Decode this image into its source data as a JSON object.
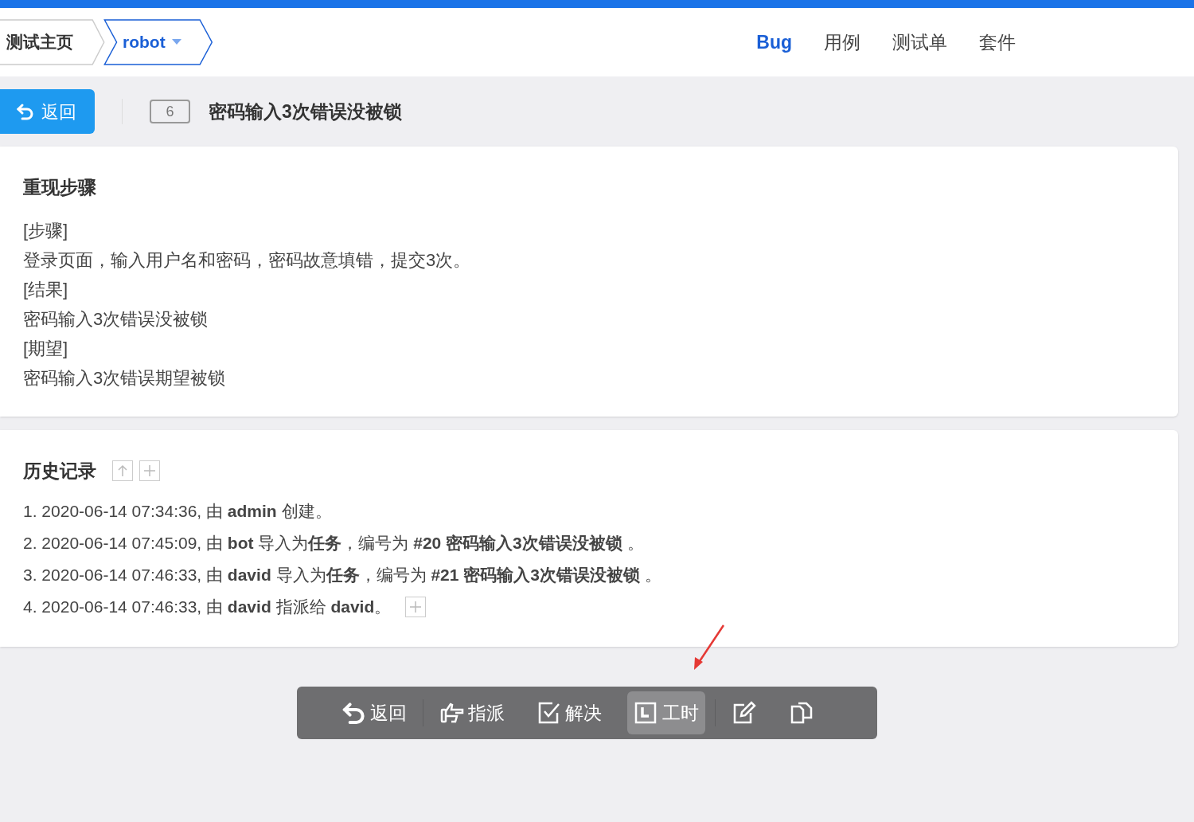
{
  "breadcrumb": [
    {
      "label": "测试主页",
      "kind": "plain"
    },
    {
      "label": "robot",
      "kind": "dropdown"
    }
  ],
  "nav_tabs": [
    {
      "label": "Bug",
      "selected": true
    },
    {
      "label": "用例",
      "selected": false
    },
    {
      "label": "测试单",
      "selected": false
    },
    {
      "label": "套件",
      "selected": false
    }
  ],
  "back_button": {
    "label": "返回"
  },
  "bug": {
    "id": "6",
    "title": "密码输入3次错误没被锁"
  },
  "steps": {
    "heading": "重现步骤",
    "lines": [
      "[步骤]",
      "登录页面，输入用户名和密码，密码故意填错，提交3次。",
      "[结果]",
      "密码输入3次错误没被锁",
      "[期望]",
      "密码输入3次错误期望被锁"
    ]
  },
  "history": {
    "heading": "历史记录",
    "entries": [
      {
        "text": "1. 2020-06-14 07:34:36, 由 **admin** 创建。",
        "expandable": false
      },
      {
        "text": "2. 2020-06-14 07:45:09, 由 **bot** 导入为**任务**，编号为 **#20 密码输入3次错误没被锁** 。",
        "expandable": false
      },
      {
        "text": "3. 2020-06-14 07:46:33, 由 **david** 导入为**任务**，编号为 **#21 密码输入3次错误没被锁** 。",
        "expandable": false
      },
      {
        "text": "4. 2020-06-14 07:46:33, 由 **david** 指派给 **david**。",
        "expandable": true
      }
    ]
  },
  "actions": [
    {
      "kind": "back",
      "label": "返回",
      "selected": false,
      "divider_after": true
    },
    {
      "kind": "assign",
      "label": "指派",
      "selected": false,
      "divider_after": false
    },
    {
      "kind": "resolve",
      "label": "解决",
      "selected": false,
      "divider_after": false
    },
    {
      "kind": "effort",
      "label": "工时",
      "selected": true,
      "divider_after": true
    },
    {
      "kind": "edit",
      "selected": false,
      "divider_after": false
    },
    {
      "kind": "copy",
      "selected": false,
      "divider_after": false
    }
  ]
}
